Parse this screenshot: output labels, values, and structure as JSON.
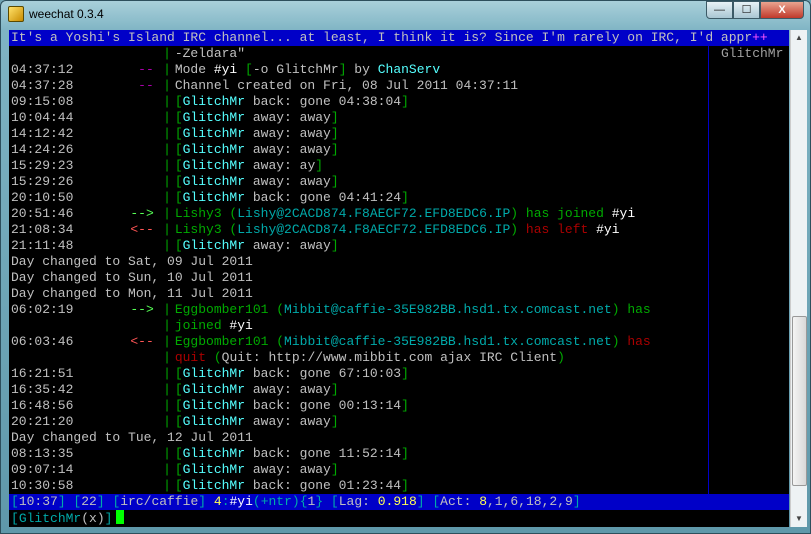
{
  "window": {
    "title": "weechat 0.3.4",
    "minimize": "—",
    "maximize": "☐",
    "close": "X"
  },
  "colors": {
    "grey": "#c0c0c0",
    "green": "#00aa00",
    "lgreen": "#55ff55",
    "cyan": "#00aaaa",
    "lcyan": "#55ffff",
    "red": "#aa0000",
    "lred": "#ff5555",
    "magenta": "#aa00aa",
    "white": "#ffffff",
    "yellow": "#ffff55"
  },
  "topic": {
    "text": "It's a Yoshi's Island IRC channel... at least, I think it is? Since I'm rarely on IRC, I'd appr",
    "more": "++"
  },
  "nicklist": [
    "GlitchMr"
  ],
  "lines": [
    {
      "time": "",
      "prefix": "",
      "pc": "grey",
      "msg": [
        {
          "t": "-Zeldara\"",
          "c": "grey"
        }
      ]
    },
    {
      "time": "04:37:12",
      "prefix": "--",
      "pc": "magenta",
      "msg": [
        {
          "t": "Mode ",
          "c": "grey"
        },
        {
          "t": "#yi ",
          "c": "white"
        },
        {
          "t": "[",
          "c": "green"
        },
        {
          "t": "-o GlitchMr",
          "c": "grey"
        },
        {
          "t": "]",
          "c": "green"
        },
        {
          "t": " by ",
          "c": "grey"
        },
        {
          "t": "ChanServ",
          "c": "lcyan"
        }
      ]
    },
    {
      "time": "04:37:28",
      "prefix": "--",
      "pc": "magenta",
      "msg": [
        {
          "t": "Channel created on Fri, 08 Jul 2011 04:37:11",
          "c": "grey"
        }
      ]
    },
    {
      "time": "09:15:08",
      "prefix": "",
      "pc": "grey",
      "msg": [
        {
          "t": "[",
          "c": "green"
        },
        {
          "t": "GlitchMr",
          "c": "lcyan"
        },
        {
          "t": " back: gone 04:38:04",
          "c": "grey"
        },
        {
          "t": "]",
          "c": "green"
        }
      ]
    },
    {
      "time": "10:04:44",
      "prefix": "",
      "pc": "grey",
      "msg": [
        {
          "t": "[",
          "c": "green"
        },
        {
          "t": "GlitchMr",
          "c": "lcyan"
        },
        {
          "t": " away: away",
          "c": "grey"
        },
        {
          "t": "]",
          "c": "green"
        }
      ]
    },
    {
      "time": "14:12:42",
      "prefix": "",
      "pc": "grey",
      "msg": [
        {
          "t": "[",
          "c": "green"
        },
        {
          "t": "GlitchMr",
          "c": "lcyan"
        },
        {
          "t": " away: away",
          "c": "grey"
        },
        {
          "t": "]",
          "c": "green"
        }
      ]
    },
    {
      "time": "14:24:26",
      "prefix": "",
      "pc": "grey",
      "msg": [
        {
          "t": "[",
          "c": "green"
        },
        {
          "t": "GlitchMr",
          "c": "lcyan"
        },
        {
          "t": " away: away",
          "c": "grey"
        },
        {
          "t": "]",
          "c": "green"
        }
      ]
    },
    {
      "time": "15:29:23",
      "prefix": "",
      "pc": "grey",
      "msg": [
        {
          "t": "[",
          "c": "green"
        },
        {
          "t": "GlitchMr",
          "c": "lcyan"
        },
        {
          "t": " away: ay",
          "c": "grey"
        },
        {
          "t": "]",
          "c": "green"
        }
      ]
    },
    {
      "time": "15:29:26",
      "prefix": "",
      "pc": "grey",
      "msg": [
        {
          "t": "[",
          "c": "green"
        },
        {
          "t": "GlitchMr",
          "c": "lcyan"
        },
        {
          "t": " away: away",
          "c": "grey"
        },
        {
          "t": "]",
          "c": "green"
        }
      ]
    },
    {
      "time": "20:10:50",
      "prefix": "",
      "pc": "grey",
      "msg": [
        {
          "t": "[",
          "c": "green"
        },
        {
          "t": "GlitchMr",
          "c": "lcyan"
        },
        {
          "t": " back: gone 04:41:24",
          "c": "grey"
        },
        {
          "t": "]",
          "c": "green"
        }
      ]
    },
    {
      "time": "20:51:46",
      "prefix": "-->",
      "pc": "lgreen",
      "msg": [
        {
          "t": "Lishy3 ",
          "c": "green"
        },
        {
          "t": "(",
          "c": "green"
        },
        {
          "t": "Lishy@2CACD874.F8AECF72.EFD8EDC6.IP",
          "c": "cyan"
        },
        {
          "t": ") ",
          "c": "green"
        },
        {
          "t": "has joined ",
          "c": "green"
        },
        {
          "t": "#yi",
          "c": "white"
        }
      ]
    },
    {
      "time": "21:08:34",
      "prefix": "<--",
      "pc": "lred",
      "msg": [
        {
          "t": "Lishy3 ",
          "c": "green"
        },
        {
          "t": "(",
          "c": "green"
        },
        {
          "t": "Lishy@2CACD874.F8AECF72.EFD8EDC6.IP",
          "c": "cyan"
        },
        {
          "t": ") ",
          "c": "green"
        },
        {
          "t": "has left ",
          "c": "red"
        },
        {
          "t": "#yi",
          "c": "white"
        }
      ]
    },
    {
      "time": "21:11:48",
      "prefix": "",
      "pc": "grey",
      "msg": [
        {
          "t": "[",
          "c": "green"
        },
        {
          "t": "GlitchMr",
          "c": "lcyan"
        },
        {
          "t": " away: away",
          "c": "grey"
        },
        {
          "t": "]",
          "c": "green"
        }
      ]
    },
    {
      "full": "Day changed to Sat, 09 Jul 2011"
    },
    {
      "full": "Day changed to Sun, 10 Jul 2011"
    },
    {
      "full": "Day changed to Mon, 11 Jul 2011"
    },
    {
      "time": "06:02:19",
      "prefix": "-->",
      "pc": "lgreen",
      "msg": [
        {
          "t": "Eggbomber101 ",
          "c": "green"
        },
        {
          "t": "(",
          "c": "green"
        },
        {
          "t": "Mibbit@caffie-35E982BB.hsd1.tx.comcast.net",
          "c": "cyan"
        },
        {
          "t": ") ",
          "c": "green"
        },
        {
          "t": "has",
          "c": "green"
        }
      ]
    },
    {
      "time": "",
      "prefix": "",
      "pc": "grey",
      "msg": [
        {
          "t": "joined ",
          "c": "green"
        },
        {
          "t": "#yi",
          "c": "white"
        }
      ]
    },
    {
      "time": "06:03:46",
      "prefix": "<--",
      "pc": "lred",
      "msg": [
        {
          "t": "Eggbomber101 ",
          "c": "green"
        },
        {
          "t": "(",
          "c": "green"
        },
        {
          "t": "Mibbit@caffie-35E982BB.hsd1.tx.comcast.net",
          "c": "cyan"
        },
        {
          "t": ") ",
          "c": "green"
        },
        {
          "t": "has",
          "c": "red"
        }
      ]
    },
    {
      "time": "",
      "prefix": "",
      "pc": "grey",
      "msg": [
        {
          "t": "quit ",
          "c": "red"
        },
        {
          "t": "(",
          "c": "green"
        },
        {
          "t": "Quit: http://www.mibbit.com ajax IRC Client",
          "c": "grey"
        },
        {
          "t": ")",
          "c": "green"
        }
      ]
    },
    {
      "time": "16:21:51",
      "prefix": "",
      "pc": "grey",
      "msg": [
        {
          "t": "[",
          "c": "green"
        },
        {
          "t": "GlitchMr",
          "c": "lcyan"
        },
        {
          "t": " back: gone 67:10:03",
          "c": "grey"
        },
        {
          "t": "]",
          "c": "green"
        }
      ]
    },
    {
      "time": "16:35:42",
      "prefix": "",
      "pc": "grey",
      "msg": [
        {
          "t": "[",
          "c": "green"
        },
        {
          "t": "GlitchMr",
          "c": "lcyan"
        },
        {
          "t": " away: away",
          "c": "grey"
        },
        {
          "t": "]",
          "c": "green"
        }
      ]
    },
    {
      "time": "16:48:56",
      "prefix": "",
      "pc": "grey",
      "msg": [
        {
          "t": "[",
          "c": "green"
        },
        {
          "t": "GlitchMr",
          "c": "lcyan"
        },
        {
          "t": " back: gone 00:13:14",
          "c": "grey"
        },
        {
          "t": "]",
          "c": "green"
        }
      ]
    },
    {
      "time": "20:21:20",
      "prefix": "",
      "pc": "grey",
      "msg": [
        {
          "t": "[",
          "c": "green"
        },
        {
          "t": "GlitchMr",
          "c": "lcyan"
        },
        {
          "t": " away: away",
          "c": "grey"
        },
        {
          "t": "]",
          "c": "green"
        }
      ]
    },
    {
      "full": "Day changed to Tue, 12 Jul 2011"
    },
    {
      "time": "08:13:35",
      "prefix": "",
      "pc": "grey",
      "msg": [
        {
          "t": "[",
          "c": "green"
        },
        {
          "t": "GlitchMr",
          "c": "lcyan"
        },
        {
          "t": " back: gone 11:52:14",
          "c": "grey"
        },
        {
          "t": "]",
          "c": "green"
        }
      ]
    },
    {
      "time": "09:07:14",
      "prefix": "",
      "pc": "grey",
      "msg": [
        {
          "t": "[",
          "c": "green"
        },
        {
          "t": "GlitchMr",
          "c": "lcyan"
        },
        {
          "t": " away: away",
          "c": "grey"
        },
        {
          "t": "]",
          "c": "green"
        }
      ]
    },
    {
      "time": "10:30:58",
      "prefix": "",
      "pc": "grey",
      "msg": [
        {
          "t": "[",
          "c": "green"
        },
        {
          "t": "GlitchMr",
          "c": "lcyan"
        },
        {
          "t": " back: gone 01:23:44",
          "c": "grey"
        },
        {
          "t": "]",
          "c": "green"
        }
      ]
    }
  ],
  "status": [
    {
      "t": "[",
      "c": "cyan"
    },
    {
      "t": "10:37",
      "c": "grey"
    },
    {
      "t": "] [",
      "c": "cyan"
    },
    {
      "t": "22",
      "c": "grey"
    },
    {
      "t": "] [",
      "c": "cyan"
    },
    {
      "t": "irc/caffie",
      "c": "grey"
    },
    {
      "t": "] ",
      "c": "cyan"
    },
    {
      "t": "4",
      "c": "yellow"
    },
    {
      "t": ":",
      "c": "cyan"
    },
    {
      "t": "#yi",
      "c": "white"
    },
    {
      "t": "(+ntr){",
      "c": "cyan"
    },
    {
      "t": "1",
      "c": "grey"
    },
    {
      "t": "} [",
      "c": "cyan"
    },
    {
      "t": "Lag: ",
      "c": "grey"
    },
    {
      "t": "0.918",
      "c": "yellow"
    },
    {
      "t": "] [",
      "c": "cyan"
    },
    {
      "t": "Act: ",
      "c": "grey"
    },
    {
      "t": "8",
      "c": "yellow"
    },
    {
      "t": ",1,6,18,2,9",
      "c": "grey"
    },
    {
      "t": "]",
      "c": "cyan"
    }
  ],
  "input": {
    "prompt_open": "[",
    "nick": "GlitchMr",
    "mode": "(x)",
    "prompt_close": "]",
    "value": ""
  }
}
